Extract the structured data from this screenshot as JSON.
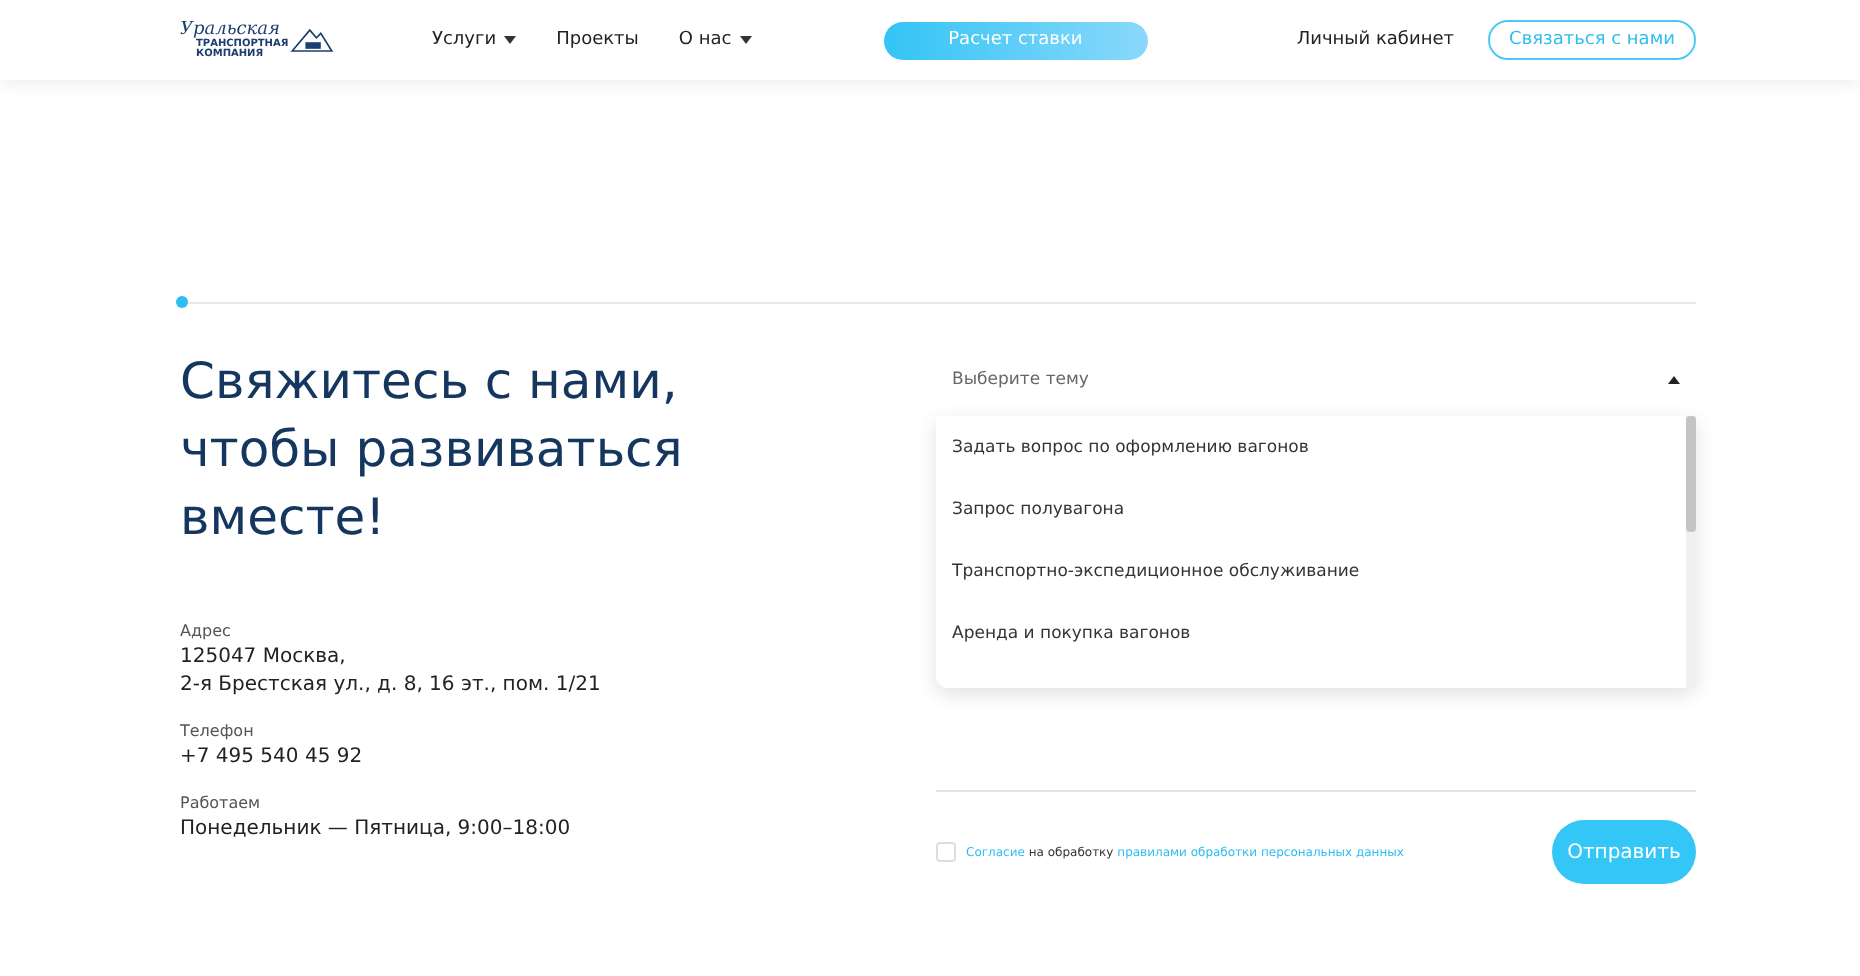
{
  "header": {
    "logo": {
      "script": "Уральская",
      "line_1": "ТРАНСПОРТНАЯ",
      "line_2": "КОМПАНИЯ"
    },
    "nav": [
      {
        "label": "Услуги",
        "has_menu": true
      },
      {
        "label": "Проекты",
        "has_menu": false
      },
      {
        "label": "О нас",
        "has_menu": true
      }
    ],
    "rate_button": "Расчет ставки",
    "account_link": "Личный кабинет",
    "contact_button": "Связаться с нами"
  },
  "contact": {
    "heading": "Свяжитесь с нами, чтобы развиваться вместе!",
    "details": [
      {
        "label": "Адрес",
        "lines": [
          "125047 Москва,",
          "2-я Брестская ул., д. 8, 16 эт., пом. 1/21"
        ]
      },
      {
        "label": "Телефон",
        "lines": [
          "+7 495 540 45 92"
        ]
      },
      {
        "label": "Работаем",
        "lines": [
          "Понедельник — Пятница, 9:00–18:00"
        ]
      }
    ]
  },
  "form": {
    "topic_select": {
      "placeholder": "Выберите тему",
      "expanded": true,
      "options": [
        "Задать вопрос по оформлению вагонов",
        "Запрос полувагона",
        "Транспортно-экспедиционное обслуживание",
        "Аренда и покупка вагонов"
      ]
    },
    "consent": {
      "checked": false,
      "link_1": "Согласие",
      "text": "на обработку",
      "link_2": "правилами обработки персональных данных"
    },
    "submit": "Отправить"
  }
}
